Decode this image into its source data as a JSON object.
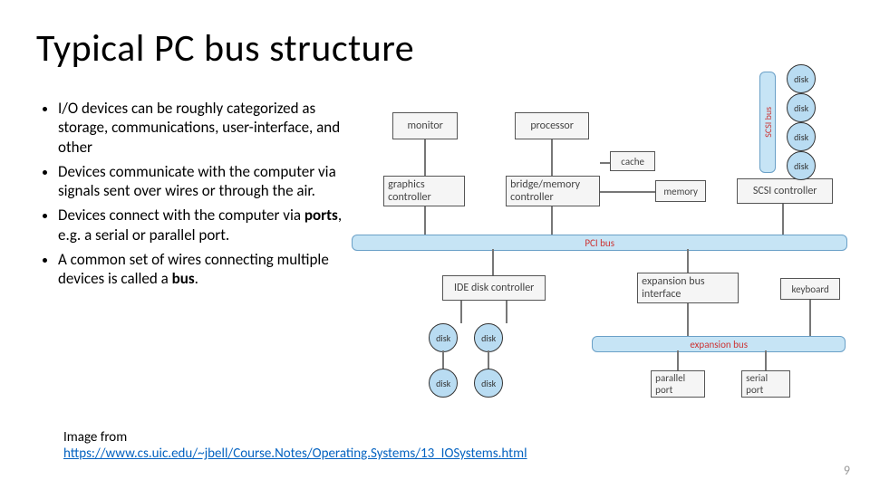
{
  "title": "Typical PC bus structure",
  "bullets": [
    "I/O devices can be roughly categorized as storage, communications, user-interface, and other",
    "Devices communicate with the computer via signals sent over wires or through the air.",
    "Devices connect with the computer via <strong>ports</strong>, e.g. a serial or parallel port.",
    "A common set of wires connecting multiple devices is called a <strong>bus</strong>."
  ],
  "diagram": {
    "boxes": {
      "monitor": "monitor",
      "processor": "processor",
      "cache": "cache",
      "graphics": "graphics controller",
      "bridge": "bridge/memory controller",
      "memory": "memory",
      "scsi_ctrl": "SCSI controller",
      "ide": "IDE disk controller",
      "exp_if": "expansion bus interface",
      "keyboard": "keyboard",
      "parallel": "parallel port",
      "serial": "serial port"
    },
    "buses": {
      "pci": "PCI bus",
      "expansion": "expansion bus",
      "scsi": "SCSI bus"
    },
    "disk_label": "disk"
  },
  "credit_label": "Image from",
  "credit_url": "https://www.cs.uic.edu/~jbell/Course.Notes/Operating.Systems/13_IOSystems.html",
  "page_number": "9"
}
